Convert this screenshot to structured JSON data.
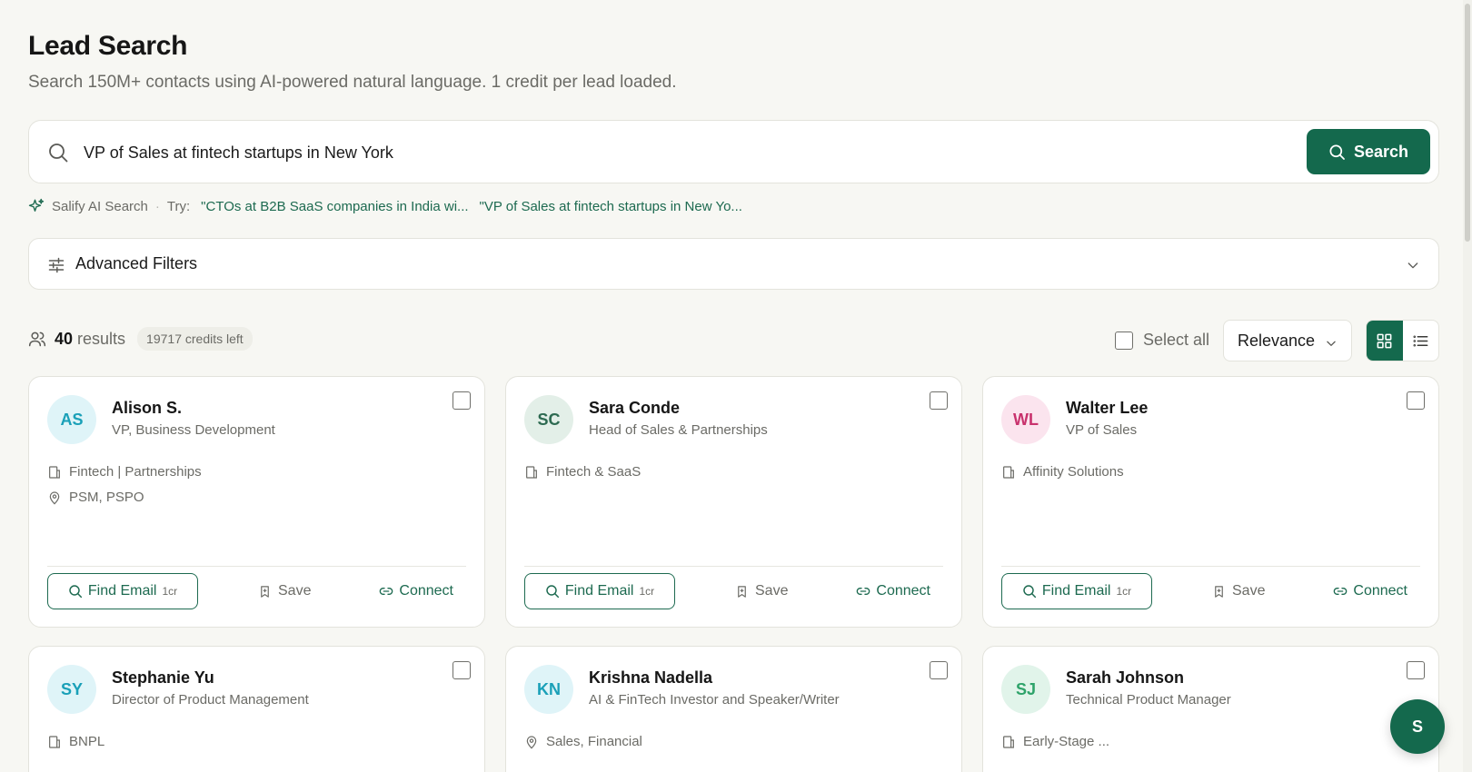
{
  "header": {
    "title": "Lead Search",
    "subtitle": "Search 150M+ contacts using AI-powered natural language. 1 credit per lead loaded."
  },
  "search": {
    "value": "VP of Sales at fintech startups in New York",
    "button_label": "Search"
  },
  "ai": {
    "label": "Salify AI Search",
    "try_label": "Try:",
    "suggestions": [
      "\"CTOs at B2B SaaS companies in India wi...",
      "\"VP of Sales at fintech startups in New Yo..."
    ]
  },
  "filters": {
    "label": "Advanced Filters"
  },
  "results": {
    "count": "40",
    "label": "results",
    "credits": "19717 credits left",
    "select_all": "Select all",
    "sort": "Relevance"
  },
  "actions": {
    "find_email": "Find Email",
    "credit_cost": "1cr",
    "save": "Save",
    "connect": "Connect"
  },
  "colors": {
    "accent": "#14694d",
    "link": "#1d6a50"
  },
  "cards": [
    {
      "initials": "AS",
      "name": "Alison S.",
      "title": "VP, Business Development",
      "avatar_bg": "#dff4f8",
      "avatar_fg": "#1aa0b8",
      "meta": [
        {
          "icon": "building-icon",
          "text": "Fintech | Partnerships"
        },
        {
          "icon": "map-pin-icon",
          "text": "PSM, PSPO"
        }
      ]
    },
    {
      "initials": "SC",
      "name": "Sara Conde",
      "title": "Head of Sales & Partnerships",
      "avatar_bg": "#e3efe8",
      "avatar_fg": "#2d6a51",
      "meta": [
        {
          "icon": "building-icon",
          "text": "Fintech & SaaS"
        }
      ]
    },
    {
      "initials": "WL",
      "name": "Walter Lee",
      "title": "VP of Sales",
      "avatar_bg": "#fbe4ee",
      "avatar_fg": "#c8326d",
      "meta": [
        {
          "icon": "building-icon",
          "text": "Affinity Solutions"
        }
      ]
    },
    {
      "initials": "SY",
      "name": "Stephanie Yu",
      "title": "Director of Product Management",
      "avatar_bg": "#dff4f8",
      "avatar_fg": "#1aa0b8",
      "meta": [
        {
          "icon": "building-icon",
          "text": "BNPL"
        }
      ]
    },
    {
      "initials": "KN",
      "name": "Krishna Nadella",
      "title": "AI & FinTech Investor and Speaker/Writer",
      "avatar_bg": "#dff4f8",
      "avatar_fg": "#1aa0b8",
      "meta": [
        {
          "icon": "map-pin-icon",
          "text": "Sales, Financial"
        }
      ]
    },
    {
      "initials": "SJ",
      "name": "Sarah Johnson",
      "title": "Technical Product Manager",
      "avatar_bg": "#e1f4ea",
      "avatar_fg": "#2ea36a",
      "meta": [
        {
          "icon": "building-icon",
          "text": "Early-Stage ..."
        }
      ]
    }
  ],
  "fab": {
    "label": "S"
  }
}
